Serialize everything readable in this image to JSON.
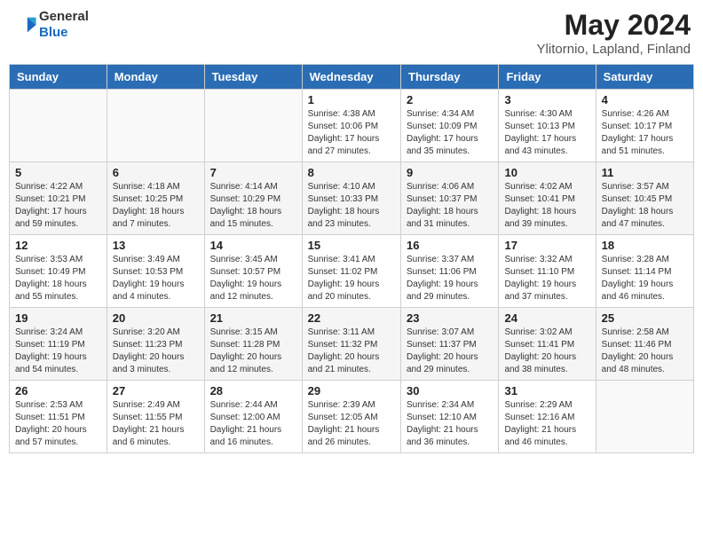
{
  "header": {
    "logo_general": "General",
    "logo_blue": "Blue",
    "month_title": "May 2024",
    "location": "Ylitornio, Lapland, Finland"
  },
  "days_of_week": [
    "Sunday",
    "Monday",
    "Tuesday",
    "Wednesday",
    "Thursday",
    "Friday",
    "Saturday"
  ],
  "weeks": [
    [
      {
        "day": "",
        "sunrise": "",
        "sunset": "",
        "daylight": ""
      },
      {
        "day": "",
        "sunrise": "",
        "sunset": "",
        "daylight": ""
      },
      {
        "day": "",
        "sunrise": "",
        "sunset": "",
        "daylight": ""
      },
      {
        "day": "1",
        "sunrise": "Sunrise: 4:38 AM",
        "sunset": "Sunset: 10:06 PM",
        "daylight": "Daylight: 17 hours and 27 minutes."
      },
      {
        "day": "2",
        "sunrise": "Sunrise: 4:34 AM",
        "sunset": "Sunset: 10:09 PM",
        "daylight": "Daylight: 17 hours and 35 minutes."
      },
      {
        "day": "3",
        "sunrise": "Sunrise: 4:30 AM",
        "sunset": "Sunset: 10:13 PM",
        "daylight": "Daylight: 17 hours and 43 minutes."
      },
      {
        "day": "4",
        "sunrise": "Sunrise: 4:26 AM",
        "sunset": "Sunset: 10:17 PM",
        "daylight": "Daylight: 17 hours and 51 minutes."
      }
    ],
    [
      {
        "day": "5",
        "sunrise": "Sunrise: 4:22 AM",
        "sunset": "Sunset: 10:21 PM",
        "daylight": "Daylight: 17 hours and 59 minutes."
      },
      {
        "day": "6",
        "sunrise": "Sunrise: 4:18 AM",
        "sunset": "Sunset: 10:25 PM",
        "daylight": "Daylight: 18 hours and 7 minutes."
      },
      {
        "day": "7",
        "sunrise": "Sunrise: 4:14 AM",
        "sunset": "Sunset: 10:29 PM",
        "daylight": "Daylight: 18 hours and 15 minutes."
      },
      {
        "day": "8",
        "sunrise": "Sunrise: 4:10 AM",
        "sunset": "Sunset: 10:33 PM",
        "daylight": "Daylight: 18 hours and 23 minutes."
      },
      {
        "day": "9",
        "sunrise": "Sunrise: 4:06 AM",
        "sunset": "Sunset: 10:37 PM",
        "daylight": "Daylight: 18 hours and 31 minutes."
      },
      {
        "day": "10",
        "sunrise": "Sunrise: 4:02 AM",
        "sunset": "Sunset: 10:41 PM",
        "daylight": "Daylight: 18 hours and 39 minutes."
      },
      {
        "day": "11",
        "sunrise": "Sunrise: 3:57 AM",
        "sunset": "Sunset: 10:45 PM",
        "daylight": "Daylight: 18 hours and 47 minutes."
      }
    ],
    [
      {
        "day": "12",
        "sunrise": "Sunrise: 3:53 AM",
        "sunset": "Sunset: 10:49 PM",
        "daylight": "Daylight: 18 hours and 55 minutes."
      },
      {
        "day": "13",
        "sunrise": "Sunrise: 3:49 AM",
        "sunset": "Sunset: 10:53 PM",
        "daylight": "Daylight: 19 hours and 4 minutes."
      },
      {
        "day": "14",
        "sunrise": "Sunrise: 3:45 AM",
        "sunset": "Sunset: 10:57 PM",
        "daylight": "Daylight: 19 hours and 12 minutes."
      },
      {
        "day": "15",
        "sunrise": "Sunrise: 3:41 AM",
        "sunset": "Sunset: 11:02 PM",
        "daylight": "Daylight: 19 hours and 20 minutes."
      },
      {
        "day": "16",
        "sunrise": "Sunrise: 3:37 AM",
        "sunset": "Sunset: 11:06 PM",
        "daylight": "Daylight: 19 hours and 29 minutes."
      },
      {
        "day": "17",
        "sunrise": "Sunrise: 3:32 AM",
        "sunset": "Sunset: 11:10 PM",
        "daylight": "Daylight: 19 hours and 37 minutes."
      },
      {
        "day": "18",
        "sunrise": "Sunrise: 3:28 AM",
        "sunset": "Sunset: 11:14 PM",
        "daylight": "Daylight: 19 hours and 46 minutes."
      }
    ],
    [
      {
        "day": "19",
        "sunrise": "Sunrise: 3:24 AM",
        "sunset": "Sunset: 11:19 PM",
        "daylight": "Daylight: 19 hours and 54 minutes."
      },
      {
        "day": "20",
        "sunrise": "Sunrise: 3:20 AM",
        "sunset": "Sunset: 11:23 PM",
        "daylight": "Daylight: 20 hours and 3 minutes."
      },
      {
        "day": "21",
        "sunrise": "Sunrise: 3:15 AM",
        "sunset": "Sunset: 11:28 PM",
        "daylight": "Daylight: 20 hours and 12 minutes."
      },
      {
        "day": "22",
        "sunrise": "Sunrise: 3:11 AM",
        "sunset": "Sunset: 11:32 PM",
        "daylight": "Daylight: 20 hours and 21 minutes."
      },
      {
        "day": "23",
        "sunrise": "Sunrise: 3:07 AM",
        "sunset": "Sunset: 11:37 PM",
        "daylight": "Daylight: 20 hours and 29 minutes."
      },
      {
        "day": "24",
        "sunrise": "Sunrise: 3:02 AM",
        "sunset": "Sunset: 11:41 PM",
        "daylight": "Daylight: 20 hours and 38 minutes."
      },
      {
        "day": "25",
        "sunrise": "Sunrise: 2:58 AM",
        "sunset": "Sunset: 11:46 PM",
        "daylight": "Daylight: 20 hours and 48 minutes."
      }
    ],
    [
      {
        "day": "26",
        "sunrise": "Sunrise: 2:53 AM",
        "sunset": "Sunset: 11:51 PM",
        "daylight": "Daylight: 20 hours and 57 minutes."
      },
      {
        "day": "27",
        "sunrise": "Sunrise: 2:49 AM",
        "sunset": "Sunset: 11:55 PM",
        "daylight": "Daylight: 21 hours and 6 minutes."
      },
      {
        "day": "28",
        "sunrise": "Sunrise: 2:44 AM",
        "sunset": "Sunset: 12:00 AM",
        "daylight": "Daylight: 21 hours and 16 minutes."
      },
      {
        "day": "29",
        "sunrise": "Sunrise: 2:39 AM",
        "sunset": "Sunset: 12:05 AM",
        "daylight": "Daylight: 21 hours and 26 minutes."
      },
      {
        "day": "30",
        "sunrise": "Sunrise: 2:34 AM",
        "sunset": "Sunset: 12:10 AM",
        "daylight": "Daylight: 21 hours and 36 minutes."
      },
      {
        "day": "31",
        "sunrise": "Sunrise: 2:29 AM",
        "sunset": "Sunset: 12:16 AM",
        "daylight": "Daylight: 21 hours and 46 minutes."
      },
      {
        "day": "",
        "sunrise": "",
        "sunset": "",
        "daylight": ""
      }
    ]
  ]
}
